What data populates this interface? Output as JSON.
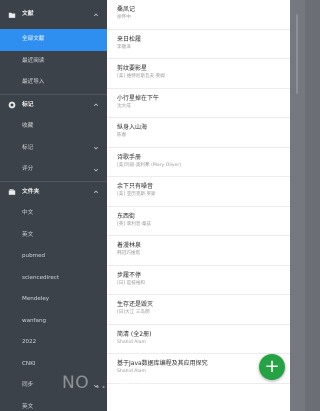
{
  "drawer": {
    "groups": [
      {
        "label": "文献",
        "icon": "folder-icon",
        "expanded": true,
        "items": [
          {
            "label": "全部文献",
            "active": true
          },
          {
            "label": "最近阅读"
          },
          {
            "label": "最近导入"
          }
        ]
      },
      {
        "label": "标记",
        "icon": "bookmark-icon",
        "expanded": true,
        "items": [
          {
            "label": "收藏"
          },
          {
            "label": "标记",
            "chevron": true
          },
          {
            "label": "评分",
            "chevron": true
          }
        ]
      },
      {
        "label": "文件夹",
        "icon": "folder-stack-icon",
        "expanded": true,
        "items": [
          {
            "label": "中文"
          },
          {
            "label": "英文"
          },
          {
            "label": "pubmed"
          },
          {
            "label": "sciencedirect"
          },
          {
            "label": "Mendeley"
          },
          {
            "label": "wanfang"
          },
          {
            "label": "2022"
          },
          {
            "label": "CNKI"
          },
          {
            "label": "同步",
            "chevron": true
          },
          {
            "label": "英文"
          }
        ]
      }
    ]
  },
  "list": [
    {
      "title": "桑凤记",
      "sub": "徐怀中"
    },
    {
      "title": "来日松履",
      "sub": "李敬泽"
    },
    {
      "title": "剪纹要影星",
      "sub": "[美] 维特尼斯瓦夫·莱姆"
    },
    {
      "title": "小行星掉在下午",
      "sub": "沈大成"
    },
    {
      "title": "纵身入山海",
      "sub": "陈春"
    },
    {
      "title": "诗歌手册",
      "sub": "[美]玛丽·奥利弗 (Mary Oliver)"
    },
    {
      "title": "余下只有噪音",
      "sub": "[美] 亚历克斯·罗斯"
    },
    {
      "title": "东西街",
      "sub": "[英] 菲利普·桑兹"
    },
    {
      "title": "着漫林泉",
      "sub": "韩冠巧维塔"
    },
    {
      "title": "步履不停",
      "sub": "[日] 是枝裕和"
    },
    {
      "title": "生存还是毁灭",
      "sub": "[日]大江 三岛明"
    },
    {
      "title": "简清 (全2册)",
      "sub": "Shahid Alam"
    },
    {
      "title": "基于Java数据库编程及其应用探究",
      "sub": "Shahid Alam"
    }
  ],
  "fab": {
    "label": "+",
    "icon": "plus-icon"
  },
  "watermark": "NO ... APP"
}
